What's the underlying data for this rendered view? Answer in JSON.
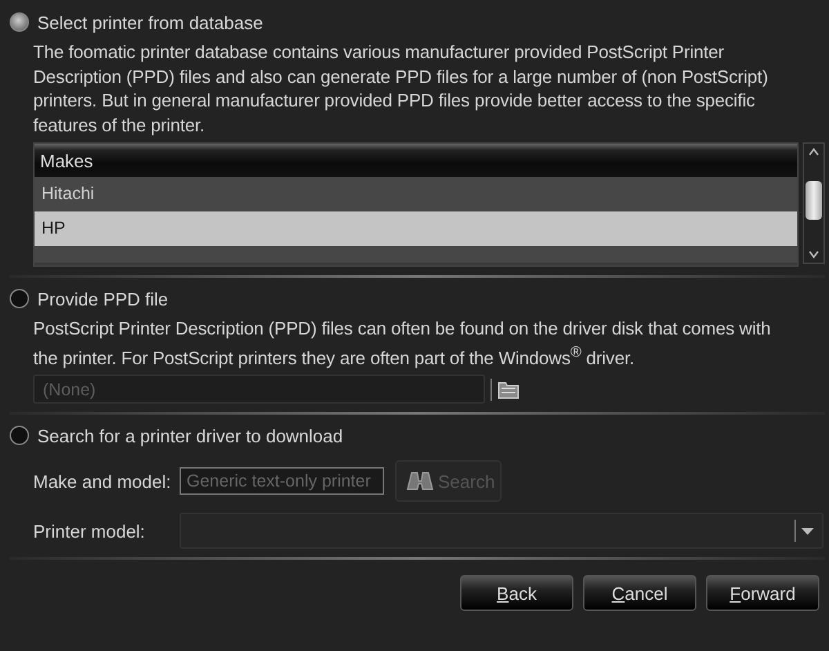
{
  "sections": [
    {
      "kind": "database",
      "label": "Select printer from database",
      "selected": true,
      "description": "The foomatic printer database contains various manufacturer provided PostScript Printer Description (PPD) files and also can generate PPD files for a large number of (non PostScript) printers. But in general manufacturer provided PPD files provide better access to the specific features of the printer.",
      "list": {
        "header": "Makes",
        "rows": [
          {
            "label": "Hitachi",
            "selected": false
          },
          {
            "label": "HP",
            "selected": true
          }
        ]
      }
    },
    {
      "kind": "file",
      "label": "Provide PPD file",
      "selected": false,
      "description": "PostScript Printer Description (PPD) files can often be found on the driver disk that comes with the printer. For PostScript printers they are often part of the Windows$^{®}$ driver.",
      "file_field": {
        "placeholder": "(None)",
        "disabled": true
      }
    },
    {
      "kind": "search",
      "label": "Search for a printer driver to download",
      "selected": false,
      "make_label": "Make and model:",
      "make_field": {
        "placeholder": "Generic text-only printer"
      },
      "search_button": {
        "label": "Search",
        "disabled": true
      },
      "model_label": "Printer model:"
    }
  ],
  "buttons": [
    {
      "label": "Back"
    },
    {
      "label": "Cancel"
    },
    {
      "label": "Forward"
    }
  ]
}
